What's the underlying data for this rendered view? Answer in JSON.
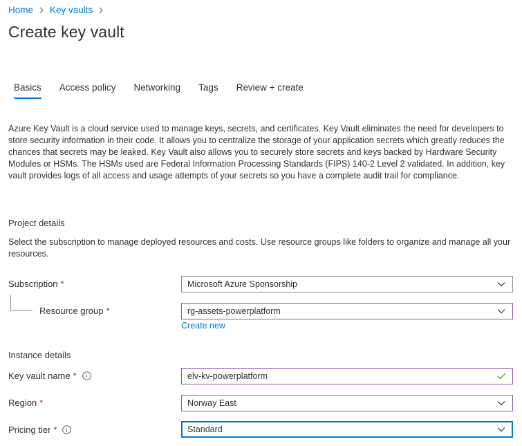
{
  "breadcrumb": [
    {
      "label": "Home"
    },
    {
      "label": "Key vaults"
    }
  ],
  "page_title": "Create key vault",
  "tabs": [
    {
      "label": "Basics",
      "active": true
    },
    {
      "label": "Access policy"
    },
    {
      "label": "Networking"
    },
    {
      "label": "Tags"
    },
    {
      "label": "Review + create"
    }
  ],
  "intro_text": "Azure Key Vault is a cloud service used to manage keys, secrets, and certificates. Key Vault eliminates the need for developers to store security information in their code. It allows you to centralize the storage of your application secrets which greatly reduces the chances that secrets may be leaked. Key Vault also allows you to securely store secrets and keys backed by Hardware Security Modules or HSMs. The HSMs used are Federal Information Processing Standards (FIPS) 140-2 Level 2 validated. In addition, key vault provides logs of all access and usage attempts of your secrets so you have a complete audit trail for compliance.",
  "project_details": {
    "heading": "Project details",
    "description": "Select the subscription to manage deployed resources and costs. Use resource groups like folders to organize and manage all your resources.",
    "subscription": {
      "label": "Subscription",
      "required_mark": "*",
      "value": "Microsoft Azure Sponsorship"
    },
    "resource_group": {
      "label": "Resource group",
      "required_mark": "*",
      "value": "rg-assets-powerplatform",
      "create_new": "Create new"
    }
  },
  "instance_details": {
    "heading": "Instance details",
    "key_vault_name": {
      "label": "Key vault name",
      "required_mark": "*",
      "value": "elv-kv-powerplatform",
      "valid_icon": "checkmark-icon"
    },
    "region": {
      "label": "Region",
      "required_mark": "*",
      "value": "Norway East"
    },
    "pricing_tier": {
      "label": "Pricing tier",
      "required_mark": "*",
      "value": "Standard"
    }
  },
  "colors": {
    "accent": "#0078d4",
    "required": "#a4262c",
    "valid": "#57a300",
    "dirty_border": "#8c4fb3"
  }
}
